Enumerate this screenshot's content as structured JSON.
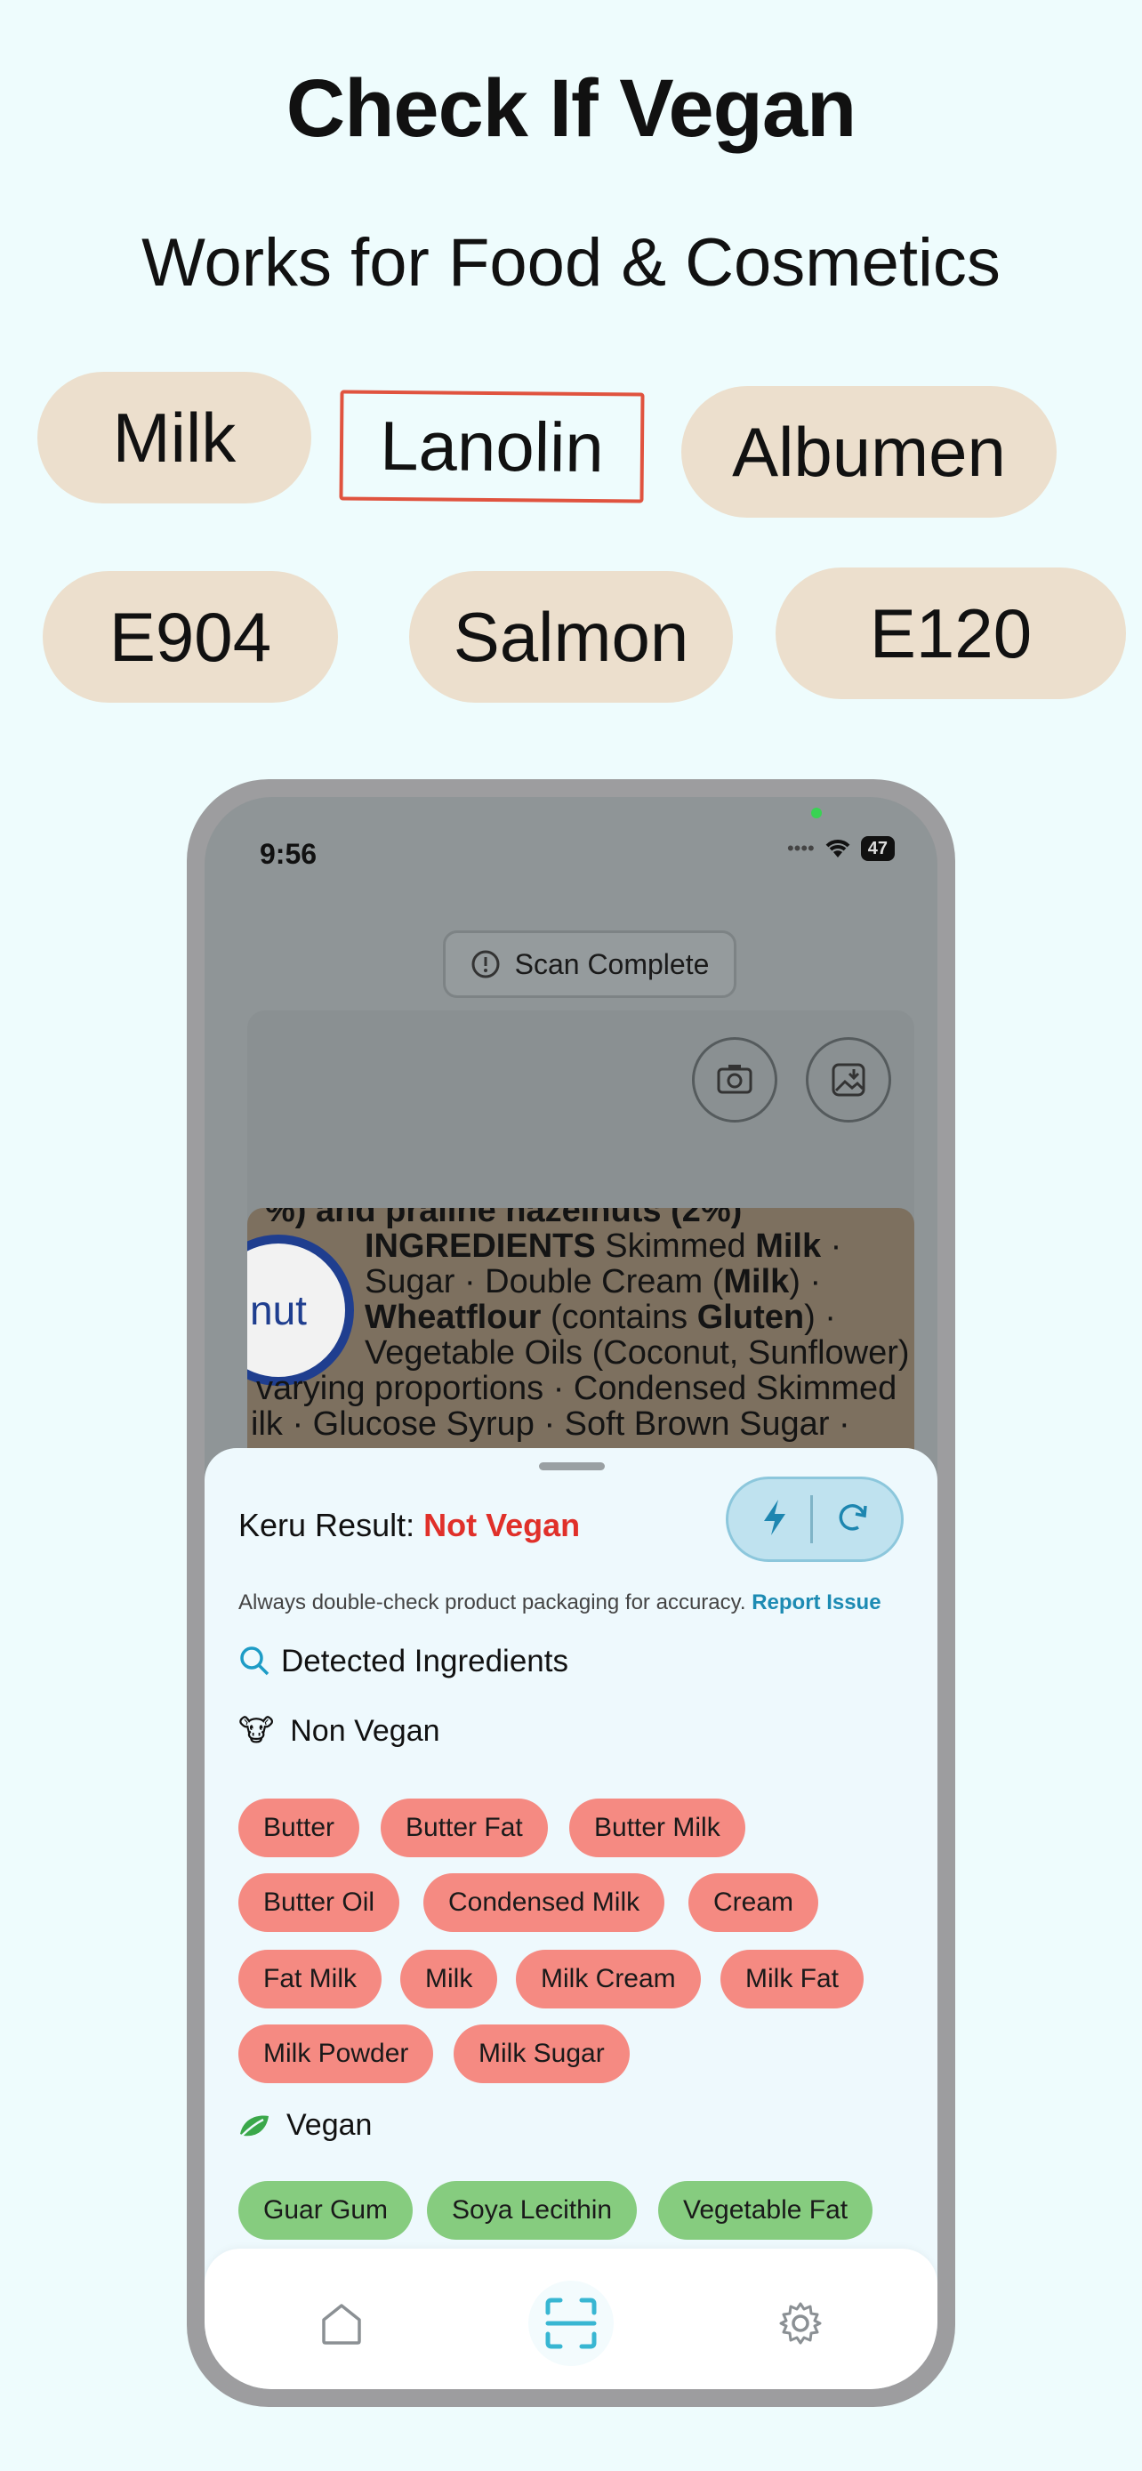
{
  "headline": "Check If Vegan",
  "subheadline": "Works for Food & Cosmetics",
  "keyword_chips": [
    "Milk",
    "Lanolin",
    "Albumen",
    "E904",
    "Salmon",
    "E120"
  ],
  "phone": {
    "status_time": "9:56",
    "battery": "47",
    "scan_status": "Scan Complete",
    "label_text": {
      "line1": "%) and praline hazelnuts (2%)",
      "line2a": "INGREDIENTS",
      "line2b": " Skimmed ",
      "line2c": "Milk",
      "line2d": " ·",
      "line3": "Sugar · Double Cream (",
      "line3b": "Milk",
      "line3c": ") ·",
      "line4a": "Wheatflour",
      "line4b": " (contains ",
      "line4c": "Gluten",
      "line4d": ") ·",
      "line5": "Vegetable Oils (Coconut, Sunflower)",
      "line6": "varying proportions · Condensed Skimmed",
      "line7": "ilk · Glucose Syrup · Soft Brown Sugar ·",
      "badge": "nut"
    },
    "result": {
      "prefix": "Keru Result: ",
      "verdict": "Not Vegan",
      "verdict_color": "#e0302a",
      "disclaimer": "Always double-check product packaging for accuracy. ",
      "report_link": "Report Issue",
      "detected_title": "Detected Ingredients",
      "non_vegan_title": "Non Vegan",
      "non_vegan_emoji": "🐮",
      "non_vegan": [
        "Butter",
        "Butter Fat",
        "Butter Milk",
        "Butter Oil",
        "Condensed Milk",
        "Cream",
        "Fat Milk",
        "Milk",
        "Milk Cream",
        "Milk Fat",
        "Milk Powder",
        "Milk Sugar"
      ],
      "vegan_title": "Vegan",
      "vegan": [
        "Guar Gum",
        "Soya Lecithin",
        "Vegetable Fat"
      ]
    },
    "tabs": [
      "home-icon",
      "scan-icon",
      "settings-icon"
    ]
  }
}
